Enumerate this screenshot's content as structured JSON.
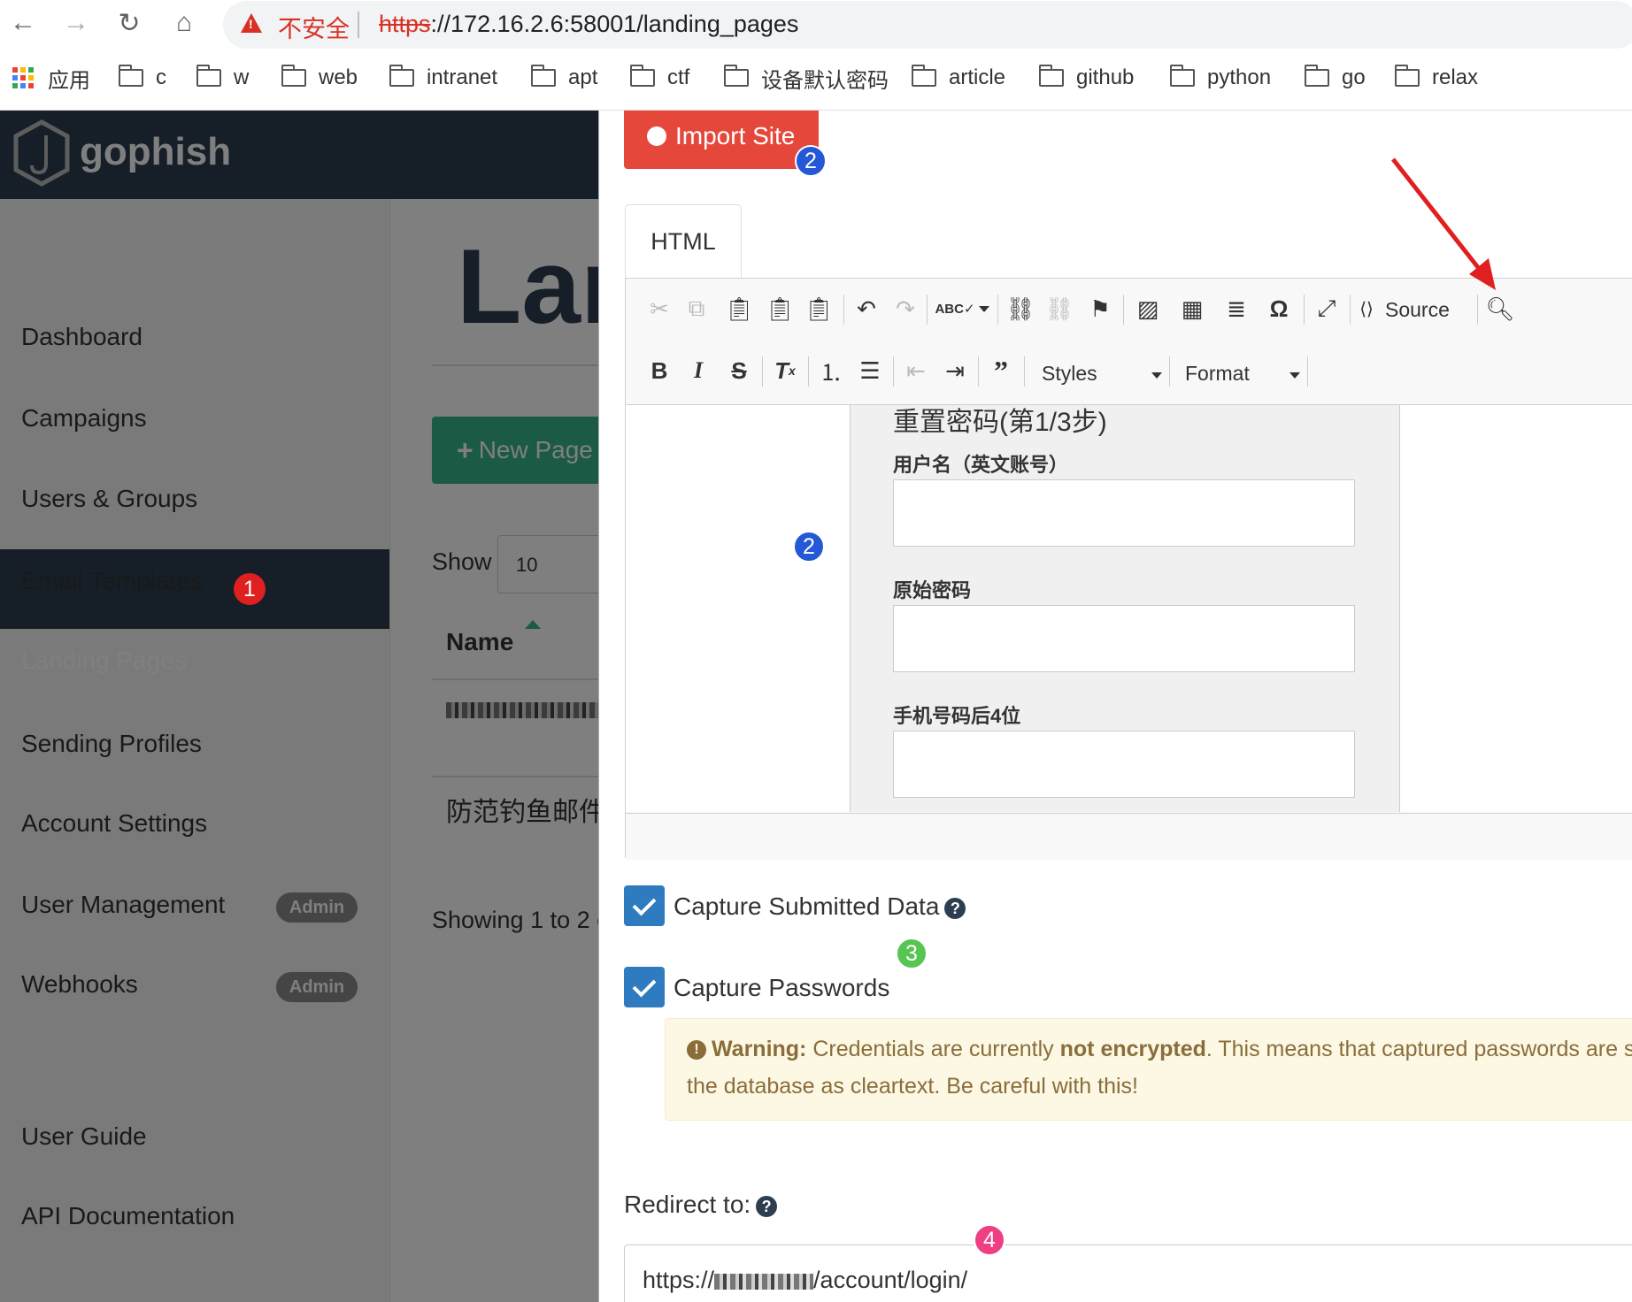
{
  "browser": {
    "insecure_label": "不安全",
    "url_scheme": "https",
    "url_rest": "://172.16.2.6:58001/landing_pages",
    "bookmarks": [
      "应用",
      "c",
      "w",
      "web",
      "intranet",
      "apt",
      "ctf",
      "设备默认密码",
      "article",
      "github",
      "python",
      "go",
      "relax"
    ]
  },
  "app": {
    "brand": "gophish",
    "nav": [
      "Dashboard",
      "Campaigns",
      "Users & Groups",
      "Email Templates",
      "Landing Pages",
      "Sending Profiles",
      "Account Settings",
      "User Management",
      "Webhooks",
      "User Guide",
      "API Documentation"
    ],
    "admin_badge": "Admin",
    "main_title": "Lan",
    "new_page_label": "New Page",
    "show_label": "Show",
    "show_value": "10",
    "name_header": "Name",
    "row2_text": "防范钓鱼邮件",
    "showing_text": "Showing 1 to 2 c"
  },
  "modal": {
    "import_site_label": "Import Site",
    "tab_html": "HTML",
    "toolbar": {
      "abc": "ABC",
      "source_label": "Source",
      "styles_label": "Styles",
      "format_label": "Format"
    },
    "form": {
      "title": "重置密码(第1/3步)",
      "username_label": "用户名（英文账号）",
      "password_label": "原始密码",
      "phone_label": "手机号码后4位"
    },
    "capture_submitted_label": "Capture Submitted Data",
    "capture_passwords_label": "Capture Passwords",
    "warning": {
      "bold_prefix": "Warning:",
      "text_a": " Credentials are currently ",
      "bold_mid": "not encrypted",
      "text_b": ". This means that captured passwords are st",
      "line2": "the database as cleartext. Be careful with this!"
    },
    "redirect_label": "Redirect to:",
    "redirect_prefix": "https://",
    "redirect_suffix": "/account/login/"
  },
  "markers": [
    "1",
    "2",
    "2",
    "3",
    "4"
  ],
  "colors": {
    "nav_active": "#2c3e50",
    "marker_red": "#e02020",
    "marker_blue": "#2458d6",
    "marker_green": "#56c552",
    "marker_pink": "#ee3f84",
    "arrow": "#e02020"
  }
}
